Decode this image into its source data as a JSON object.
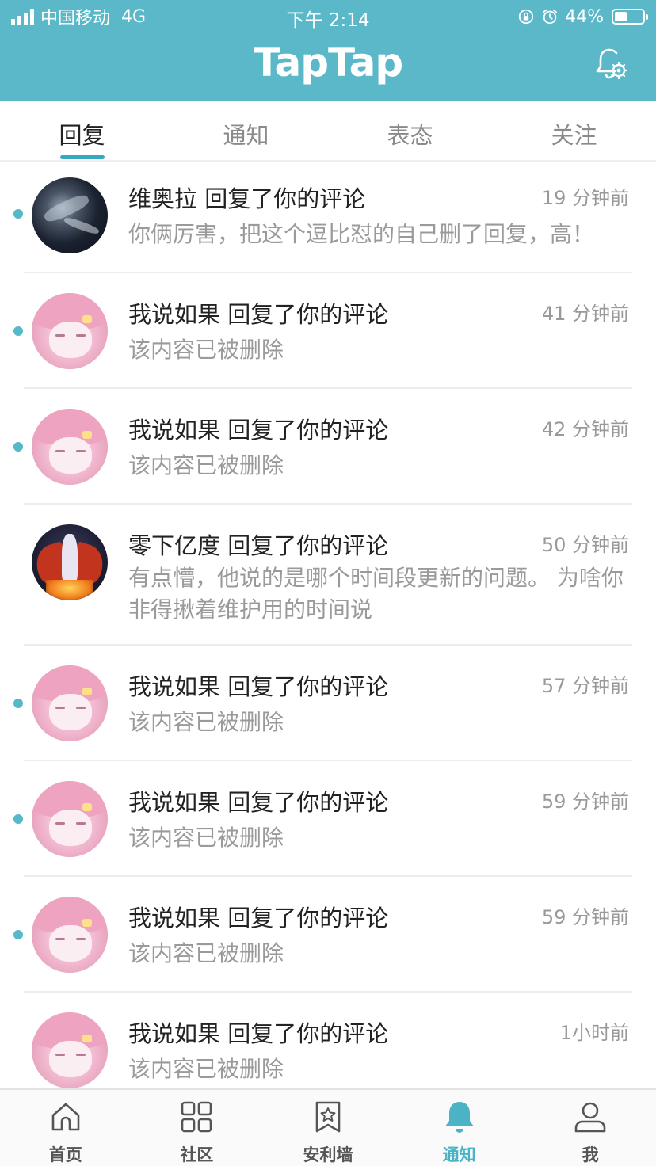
{
  "status_bar": {
    "carrier": "中国移动",
    "network": "4G",
    "time": "下午 2:14",
    "battery_percent": "44%",
    "battery_level": 0.44,
    "icons": [
      "signal-icon",
      "orientation-lock-icon",
      "alarm-icon",
      "battery-icon"
    ]
  },
  "header": {
    "app_title": "TapTap",
    "settings_icon": "bell-gear-icon",
    "background_color": "#5ab8c8"
  },
  "tabs": [
    {
      "label": "回复",
      "active": true
    },
    {
      "label": "通知",
      "active": false
    },
    {
      "label": "表态",
      "active": false
    },
    {
      "label": "关注",
      "active": false
    }
  ],
  "accent_color": "#35a9bf",
  "notifications": [
    {
      "user": "维奥拉",
      "action": "回复了你的评论",
      "time": "19 分钟前",
      "body": "你俩厉害，把这个逗比怼的自己删了回复，高！",
      "unread": true,
      "avatar": "rock-avatar"
    },
    {
      "user": "我说如果",
      "action": "回复了你的评论",
      "time": "41 分钟前",
      "body": "该内容已被删除",
      "unread": true,
      "avatar": "pink-anime-avatar"
    },
    {
      "user": "我说如果",
      "action": "回复了你的评论",
      "time": "42 分钟前",
      "body": "该内容已被删除",
      "unread": true,
      "avatar": "pink-anime-avatar"
    },
    {
      "user": "零下亿度",
      "action": "回复了你的评论",
      "time": "50 分钟前",
      "body": "有点懵，他说的是哪个时间段更新的问题。 为啥你非得揪着维护用的时间说",
      "unread": false,
      "avatar": "angel-anime-avatar"
    },
    {
      "user": "我说如果",
      "action": "回复了你的评论",
      "time": "57 分钟前",
      "body": "该内容已被删除",
      "unread": true,
      "avatar": "pink-anime-avatar"
    },
    {
      "user": "我说如果",
      "action": "回复了你的评论",
      "time": "59 分钟前",
      "body": "该内容已被删除",
      "unread": true,
      "avatar": "pink-anime-avatar"
    },
    {
      "user": "我说如果",
      "action": "回复了你的评论",
      "time": "59 分钟前",
      "body": "该内容已被删除",
      "unread": true,
      "avatar": "pink-anime-avatar"
    },
    {
      "user": "我说如果",
      "action": "回复了你的评论",
      "time": "1小时前",
      "body": "该内容已被删除",
      "unread": false,
      "avatar": "pink-anime-avatar"
    }
  ],
  "bottom_nav": [
    {
      "label": "首页",
      "icon": "home-icon",
      "active": false
    },
    {
      "label": "社区",
      "icon": "grid-icon",
      "active": false
    },
    {
      "label": "安利墙",
      "icon": "bookmark-star-icon",
      "active": false
    },
    {
      "label": "通知",
      "icon": "bell-icon",
      "active": true
    },
    {
      "label": "我",
      "icon": "person-icon",
      "active": false
    }
  ]
}
